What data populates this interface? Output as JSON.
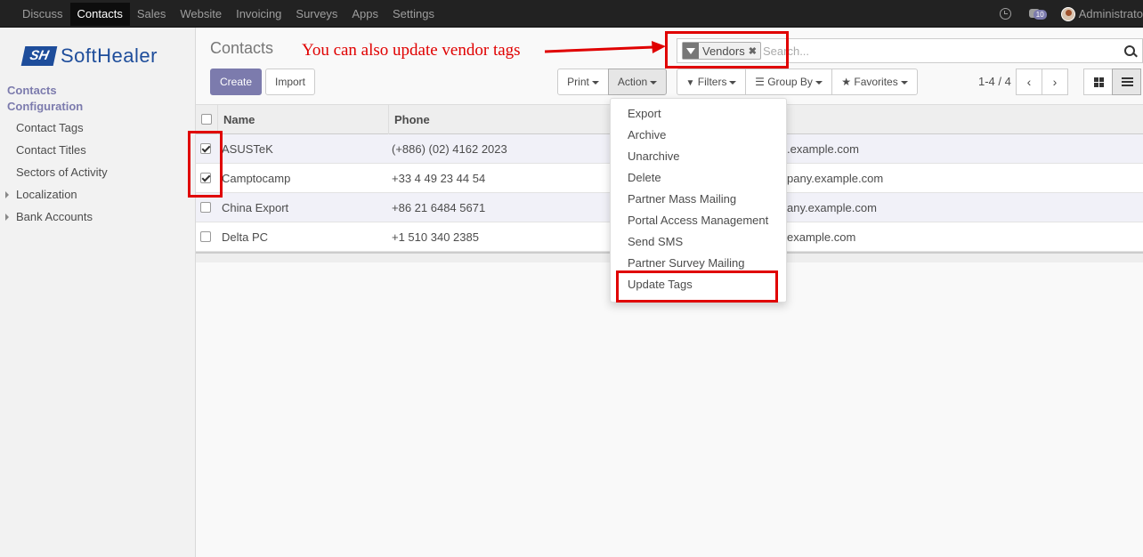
{
  "topbar": {
    "menu": [
      "Discuss",
      "Contacts",
      "Sales",
      "Website",
      "Invoicing",
      "Surveys",
      "Apps",
      "Settings"
    ],
    "active_index": 1,
    "chat_badge": "10",
    "user": "Administrato"
  },
  "sidebar": {
    "logo_mark": "SH",
    "logo_text": "SoftHealer",
    "contacts_heading": "Contacts",
    "config_heading": "Configuration",
    "items": [
      "Contact Tags",
      "Contact Titles",
      "Sectors of Activity",
      "Localization",
      "Bank Accounts"
    ]
  },
  "control_panel": {
    "title": "Contacts",
    "create_label": "Create",
    "import_label": "Import",
    "print_label": "Print",
    "action_label": "Action",
    "filters_label": "Filters",
    "groupby_label": "Group By",
    "favorites_label": "Favorites",
    "pager": "1-4 / 4"
  },
  "search": {
    "facet": "Vendors",
    "placeholder": "Search..."
  },
  "annotation": "You can also update vendor tags",
  "table": {
    "headers": [
      "Name",
      "Phone"
    ],
    "rows": [
      {
        "name": "ASUSTeK",
        "phone": "(+886) (02) 4162 2023",
        "email": ".example.com",
        "checked": true
      },
      {
        "name": "Camptocamp",
        "phone": "+33 4 49 23 44 54",
        "email": "pany.example.com",
        "checked": true
      },
      {
        "name": "China Export",
        "phone": "+86 21 6484 5671",
        "email": "any.example.com",
        "checked": false
      },
      {
        "name": "Delta PC",
        "phone": "+1 510 340 2385",
        "email": "example.com",
        "checked": false
      }
    ]
  },
  "action_menu": [
    "Export",
    "Archive",
    "Unarchive",
    "Delete",
    "Partner Mass Mailing",
    "Portal Access Management",
    "Send SMS",
    "Partner Survey Mailing",
    "Update Tags"
  ],
  "colors": {
    "brand": "#7c7bad",
    "highlight": "#e00000",
    "logo": "#1e4d9b"
  }
}
